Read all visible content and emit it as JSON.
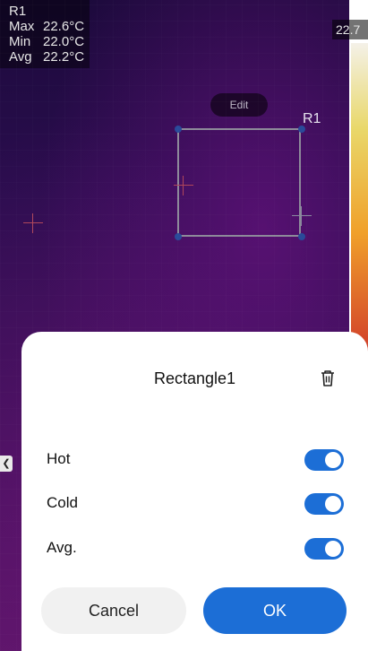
{
  "thermal_view": {
    "region_label": "R1",
    "stats": {
      "max_label": "Max",
      "max_value": "22.6°C",
      "min_label": "Min",
      "min_value": "22.0°C",
      "avg_label": "Avg",
      "avg_value": "22.2°C"
    },
    "scale_top_value": "22.7",
    "edit_label": "Edit",
    "rectangle_label": "R1"
  },
  "sheet": {
    "title": "Rectangle1",
    "toggles": [
      {
        "label": "Hot",
        "on": true
      },
      {
        "label": "Cold",
        "on": true
      },
      {
        "label": "Avg.",
        "on": true
      }
    ],
    "cancel_label": "Cancel",
    "ok_label": "OK"
  },
  "colors": {
    "accent": "#1c6ed6",
    "sheet_bg": "#ffffff",
    "cancel_bg": "#f1f1f1"
  },
  "icons": {
    "delete": "trash-icon",
    "side_handle": "chevron-left-icon"
  }
}
